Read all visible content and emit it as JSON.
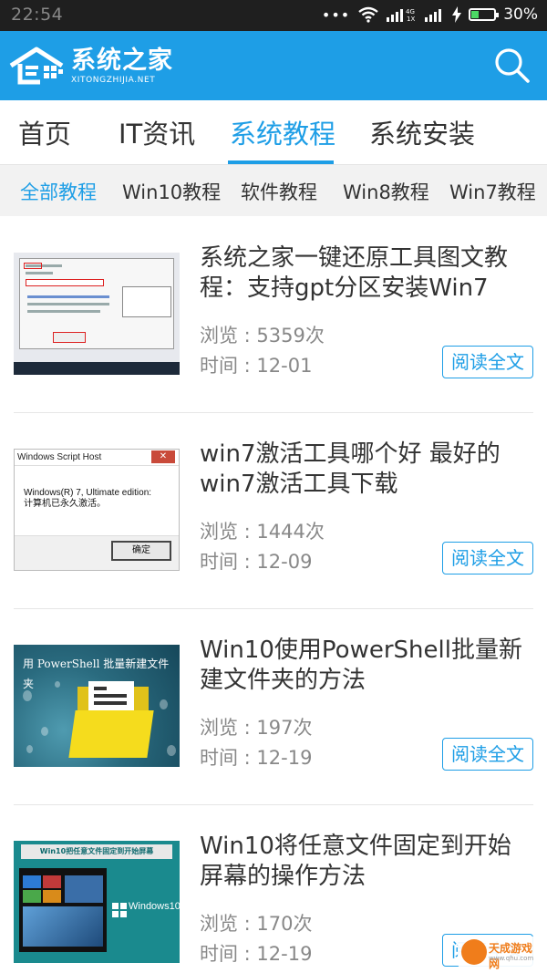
{
  "status_bar": {
    "time": "22:54",
    "signal_left": "4G",
    "battery_percent": "30%",
    "battery_level": 0.3
  },
  "app": {
    "logo_cn": "系统之家",
    "logo_en": "XITONGZHIJIA.NET",
    "accent_color": "#1e9ee6"
  },
  "tabs": [
    {
      "label": "首页"
    },
    {
      "label": "IT资讯"
    },
    {
      "label": "系统教程",
      "active": true
    },
    {
      "label": "系统安装"
    }
  ],
  "subtabs": [
    {
      "label": "全部教程",
      "active": true
    },
    {
      "label": "Win10教程"
    },
    {
      "label": "软件教程"
    },
    {
      "label": "Win8教程"
    },
    {
      "label": "Win7教程"
    }
  ],
  "articles": [
    {
      "title": "系统之家一键还原工具图文教程：支持gpt分区安装Win7",
      "views": "浏览 : 5359次",
      "time": "时间 : 12-01",
      "read_label": "阅读全文",
      "thumb": "restore-tool-screenshot"
    },
    {
      "title": "win7激活工具哪个好 最好的win7激活工具下载",
      "views": "浏览 : 1444次",
      "time": "时间 : 12-09",
      "read_label": "阅读全文",
      "thumb": "windows-script-host-dialog",
      "thumb_text": {
        "title": "Windows Script Host",
        "line1": "Windows(R) 7, Ultimate edition:",
        "line2": "计算机已永久激活。",
        "ok": "确定"
      }
    },
    {
      "title": "Win10使用PowerShell批量新建文件夹的方法",
      "views": "浏览 : 197次",
      "time": "时间 : 12-19",
      "read_label": "阅读全文",
      "thumb": "powershell-folder",
      "thumb_text": {
        "banner": "用 PowerShell 批量新建文件夹"
      }
    },
    {
      "title": "Win10将任意文件固定到开始屏幕的操作方法",
      "views": "浏览 : 170次",
      "time": "时间 : 12-19",
      "read_label": "阅读全文",
      "thumb": "win10-tablet",
      "thumb_text": {
        "banner": "Win10把任意文件固定到开始屏幕",
        "brand": "Windows10"
      }
    }
  ],
  "watermark": {
    "text": "天成游戏网",
    "sub": "www.qhu.com"
  }
}
